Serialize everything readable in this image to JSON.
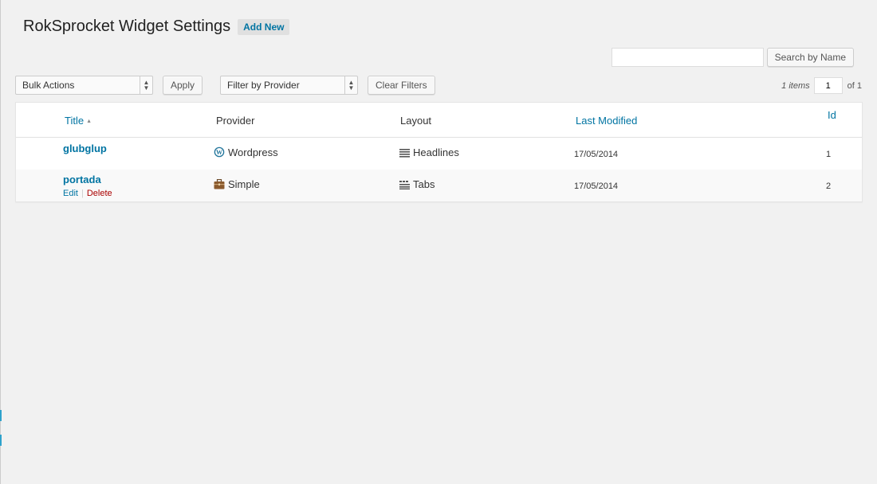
{
  "header": {
    "title": "RokSprocket Widget Settings",
    "add_new_label": "Add New"
  },
  "search": {
    "value": "",
    "placeholder": "",
    "button_label": "Search by Name"
  },
  "toolbar": {
    "bulk_actions": "Bulk Actions",
    "apply_label": "Apply",
    "filter_provider": "Filter by Provider",
    "clear_filters_label": "Clear Filters"
  },
  "pagination": {
    "items": "1 items",
    "current_page": "1",
    "of_label": "of 1"
  },
  "table": {
    "columns": {
      "title": "Title",
      "provider": "Provider",
      "layout": "Layout",
      "modified": "Last Modified",
      "id": "Id"
    },
    "rows": [
      {
        "title": "glubglup",
        "provider": "Wordpress",
        "provider_icon": "wordpress-icon",
        "layout": "Headlines",
        "layout_icon": "headlines-icon",
        "modified": "17/05/2014",
        "id": "1"
      },
      {
        "title": "portada",
        "provider": "Simple",
        "provider_icon": "briefcase-icon",
        "layout": "Tabs",
        "layout_icon": "tabs-icon",
        "modified": "17/05/2014",
        "id": "2",
        "actions": {
          "edit": "Edit",
          "delete": "Delete"
        }
      }
    ]
  },
  "colors": {
    "link": "#0074a2",
    "delete": "#aa0000",
    "background": "#f1f1f1"
  }
}
